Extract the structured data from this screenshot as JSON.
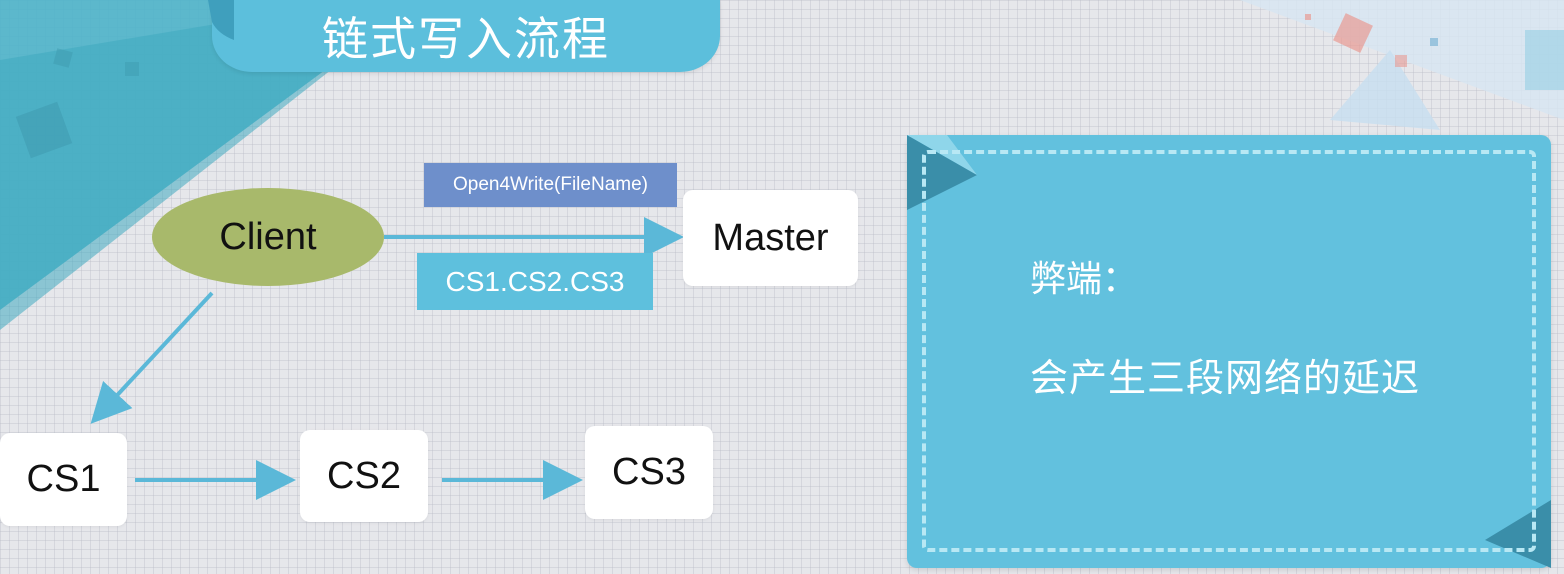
{
  "title": "链式写入流程",
  "nodes": {
    "client": "Client",
    "master": "Master",
    "cs1": "CS1",
    "cs2": "CS2",
    "cs3": "CS3"
  },
  "edge_labels": {
    "request": "Open4Write(FileName)",
    "response": "CS1.CS2.CS3"
  },
  "note": {
    "label": "弊端：",
    "text": "会产生三段网络的延迟"
  },
  "colors": {
    "accent": "#5cbfdc",
    "client_fill": "#a8b96b",
    "request_tag": "#6e8fcb",
    "arrow": "#5bb8d8"
  }
}
